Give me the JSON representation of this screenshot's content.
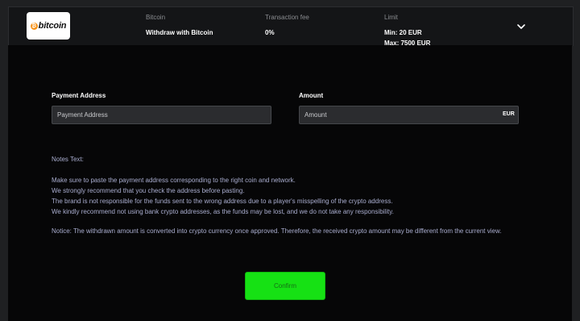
{
  "header": {
    "logo_text": "bitcoin",
    "logo_coin_symbol": "₿",
    "method": {
      "label": "Bitcoin",
      "value": "Withdraw with Bitcoin"
    },
    "fee": {
      "label": "Transaction fee",
      "value": "0%"
    },
    "limit": {
      "label": "Limit",
      "min": "Min: 20 EUR",
      "max": "Max: 7500 EUR"
    },
    "toggle_icon": "chevron-down-icon"
  },
  "form": {
    "address": {
      "label": "Payment Address",
      "placeholder": "Payment Address",
      "value": ""
    },
    "amount": {
      "label": "Amount",
      "placeholder": "Amount",
      "value": "",
      "currency": "EUR"
    }
  },
  "notes": {
    "title": "Notes Text:",
    "lines": [
      "Make sure to paste the payment address corresponding to the right coin and network.",
      "We strongly recommend that you check the address before pasting.",
      "The brand is not responsible for the funds sent to the wrong address due to a player's misspelling of the crypto address.",
      "We kindly recommend not using bank crypto addresses, as the funds may be lost, and we do not take any responsibility."
    ],
    "notice": "Notice: The withdrawn amount is converted into crypto currency once approved. Therefore, the received crypto amount may be different from the current view."
  },
  "confirm_label": "Confirm",
  "colors": {
    "accent_green": "#16e114",
    "bitcoin_orange": "#f7931a",
    "notes_text": "#a9adcf"
  }
}
